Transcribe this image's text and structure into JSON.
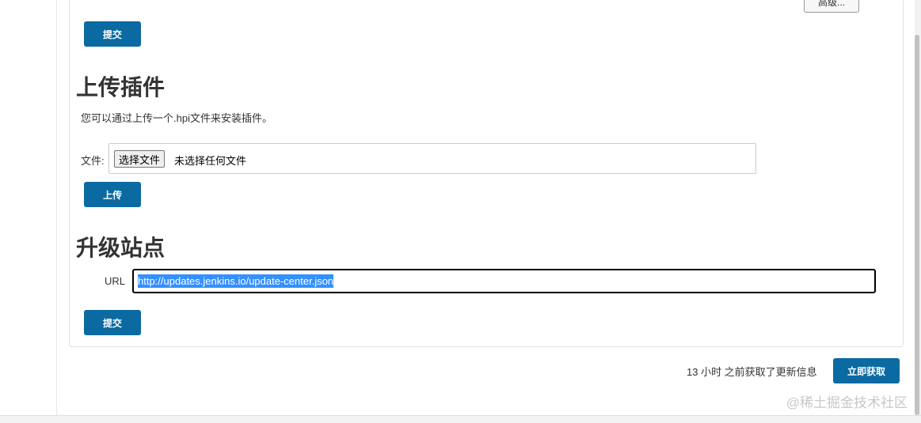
{
  "advanced_button": "高级...",
  "top_submit": "提交",
  "upload_section": {
    "title": "上传插件",
    "description": "您可以通过上传一个.hpi文件来安装插件。",
    "file_label": "文件:",
    "choose_button": "选择文件",
    "no_file_text": "未选择任何文件",
    "upload_button": "上传"
  },
  "update_site_section": {
    "title": "升级站点",
    "url_label": "URL",
    "url_value": "http://updates.jenkins.io/update-center.json",
    "submit_button": "提交"
  },
  "footer": {
    "updated_text": "13 小时 之前获取了更新信息",
    "check_now_button": "立即获取"
  },
  "watermark": "@稀土掘金技术社区",
  "colors": {
    "primary": "#0b6aa2",
    "selection": "#3390ff"
  }
}
